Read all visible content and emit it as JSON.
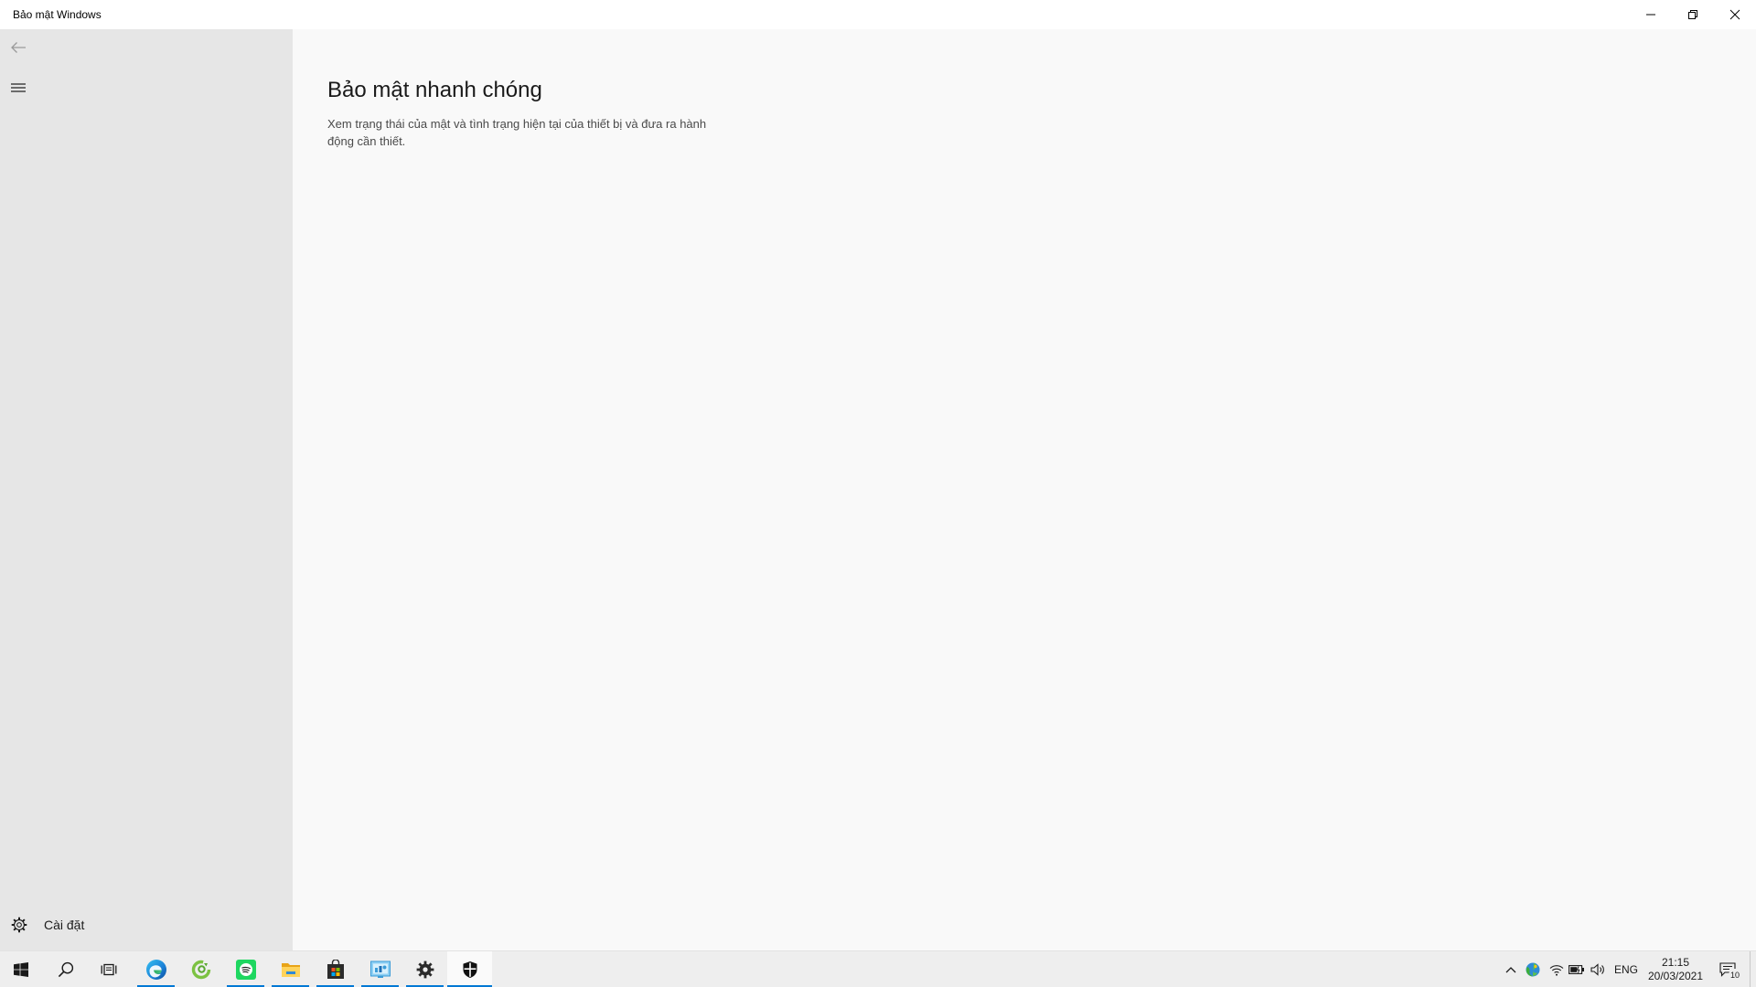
{
  "window": {
    "title": "Bảo mật Windows",
    "controls": {
      "minimize_icon": "minimize-icon",
      "restore_icon": "restore-icon",
      "close_icon": "close-icon"
    }
  },
  "nav": {
    "back_icon": "back-arrow-icon",
    "menu_icon": "hamburger-menu-icon",
    "settings": {
      "icon": "gear-icon",
      "label": "Cài đặt"
    }
  },
  "main": {
    "heading": "Bảo mật nhanh chóng",
    "description": "Xem trạng thái của mật và tình trạng hiện tại của thiết bị và đưa ra hành động cần thiết."
  },
  "taskbar": {
    "start_icon": "windows-logo-icon",
    "search_icon": "search-icon",
    "task_view_icon": "task-view-icon",
    "apps": [
      {
        "icon": "edge-icon",
        "running": true,
        "active": false
      },
      {
        "icon": "green-app-icon",
        "running": false,
        "active": false
      },
      {
        "icon": "spotify-icon",
        "running": true,
        "active": false
      },
      {
        "icon": "file-explorer-icon",
        "running": true,
        "active": false
      },
      {
        "icon": "microsoft-store-icon",
        "running": true,
        "active": false
      },
      {
        "icon": "control-panel-icon",
        "running": true,
        "active": false
      },
      {
        "icon": "settings-icon",
        "running": true,
        "active": false
      },
      {
        "icon": "windows-security-icon",
        "running": true,
        "active": true
      }
    ]
  },
  "tray": {
    "chevron_icon": "chevron-up-icon",
    "app_icon": "tray-app-icon",
    "wifi_icon": "wifi-icon",
    "battery_icon": "battery-icon",
    "volume_icon": "volume-icon",
    "language": "ENG",
    "time": "21:15",
    "date": "20/03/2021",
    "notification_icon": "notification-icon",
    "notification_count": "10"
  },
  "colors": {
    "accent": "#0078d4",
    "titlebar_bg": "#ffffff",
    "sidebar_bg": "#e6e6e6",
    "content_bg": "#f9f9f9",
    "taskbar_bg": "#eeeeee"
  }
}
